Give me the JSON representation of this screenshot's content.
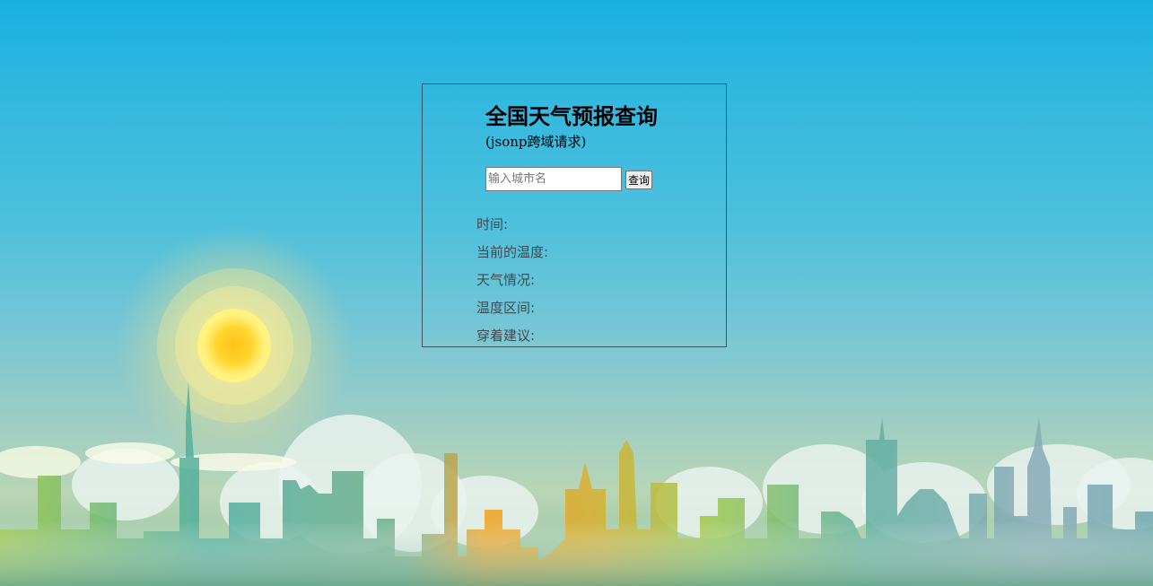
{
  "page": {
    "title": "全国天气预报查询",
    "subtitle": "(jsonp跨域请求)"
  },
  "search": {
    "placeholder": "输入城市名",
    "value": "",
    "button_label": "查询"
  },
  "results": {
    "time_label": "时间:",
    "temperature_label": "当前的温度:",
    "weather_label": "天气情况:",
    "range_label": "温度区间:",
    "dressing_label": "穿着建议:"
  },
  "colors": {
    "sky_top": "#1aafe0",
    "sky_mid": "#4dc0dc",
    "sun": "#ffd22c",
    "panel_border": "#3b5560"
  }
}
